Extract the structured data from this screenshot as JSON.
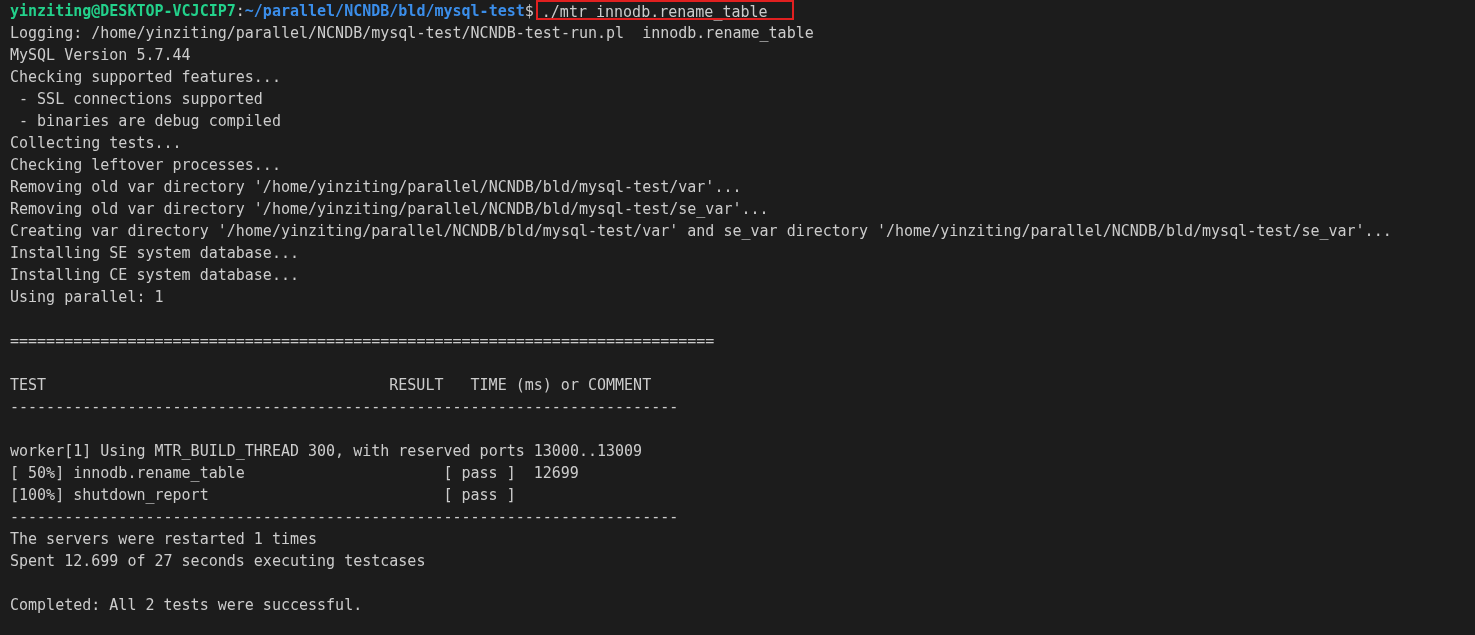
{
  "terminal": {
    "prompt": {
      "user_host": "yinziting@DESKTOP-VCJCIP7",
      "separator": ":",
      "path": "~/parallel/NCNDB/bld/mysql-test",
      "symbol": "$",
      "command": "./mtr innodb.rename_table",
      "highlighted": true
    },
    "lines": [
      {
        "kind": "text",
        "text": "Logging: /home/yinziting/parallel/NCNDB/mysql-test/NCNDB-test-run.pl  innodb.rename_table"
      },
      {
        "kind": "text",
        "text": "MySQL Version 5.7.44"
      },
      {
        "kind": "text",
        "text": "Checking supported features..."
      },
      {
        "kind": "text",
        "text": " - SSL connections supported"
      },
      {
        "kind": "text",
        "text": " - binaries are debug compiled"
      },
      {
        "kind": "text",
        "text": "Collecting tests..."
      },
      {
        "kind": "text",
        "text": "Checking leftover processes..."
      },
      {
        "kind": "text",
        "text": "Removing old var directory '/home/yinziting/parallel/NCNDB/bld/mysql-test/var'..."
      },
      {
        "kind": "text",
        "text": "Removing old var directory '/home/yinziting/parallel/NCNDB/bld/mysql-test/se_var'..."
      },
      {
        "kind": "text",
        "text": "Creating var directory '/home/yinziting/parallel/NCNDB/bld/mysql-test/var' and se_var directory '/home/yinziting/parallel/NCNDB/bld/mysql-test/se_var'..."
      },
      {
        "kind": "text",
        "text": "Installing SE system database..."
      },
      {
        "kind": "text",
        "text": "Installing CE system database..."
      },
      {
        "kind": "text",
        "text": "Using parallel: 1"
      },
      {
        "kind": "blank"
      },
      {
        "kind": "rule",
        "text": "=============================================================================="
      },
      {
        "kind": "blank"
      },
      {
        "kind": "header",
        "columns": [
          "TEST",
          "RESULT",
          "TIME (ms) or COMMENT"
        ]
      },
      {
        "kind": "rule",
        "text": "--------------------------------------------------------------------------"
      },
      {
        "kind": "blank"
      },
      {
        "kind": "text",
        "text": "worker[1] Using MTR_BUILD_THREAD 300, with reserved ports 13000..13009"
      },
      {
        "kind": "result",
        "progress": "[ 50%]",
        "test": "innodb.rename_table",
        "status": "[ pass ]",
        "time": "12699"
      },
      {
        "kind": "result",
        "progress": "[100%]",
        "test": "shutdown_report",
        "status": "[ pass ]"
      },
      {
        "kind": "rule",
        "text": "--------------------------------------------------------------------------"
      },
      {
        "kind": "text",
        "text": "The servers were restarted 1 times"
      },
      {
        "kind": "text",
        "text": "Spent 12.699 of 27 seconds executing testcases"
      },
      {
        "kind": "blank"
      },
      {
        "kind": "text",
        "text": "Completed: All 2 tests were successful."
      }
    ]
  }
}
